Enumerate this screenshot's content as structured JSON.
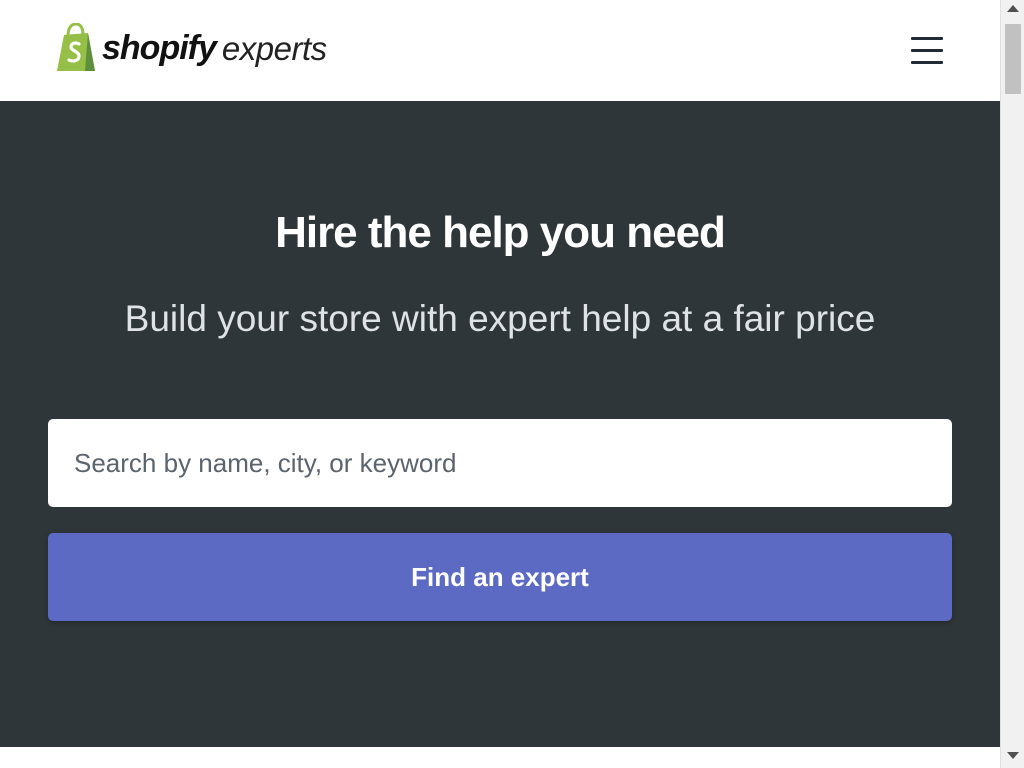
{
  "header": {
    "logo": {
      "brand": "shopify",
      "product": "experts",
      "icon": "shopify-bag-icon",
      "brand_color": "#95bf47"
    },
    "menu_icon": "hamburger-menu-icon"
  },
  "hero": {
    "title": "Hire the help you need",
    "subtitle": "Build your store with expert help at a fair price",
    "background_color": "#2f3639"
  },
  "search": {
    "value": "",
    "placeholder": "Search by name, city, or keyword"
  },
  "find_button": {
    "label": "Find an expert",
    "color": "#5c6ac4"
  },
  "scrollbar": {
    "up_icon": "scroll-up-arrow-icon",
    "down_icon": "scroll-down-arrow-icon"
  }
}
